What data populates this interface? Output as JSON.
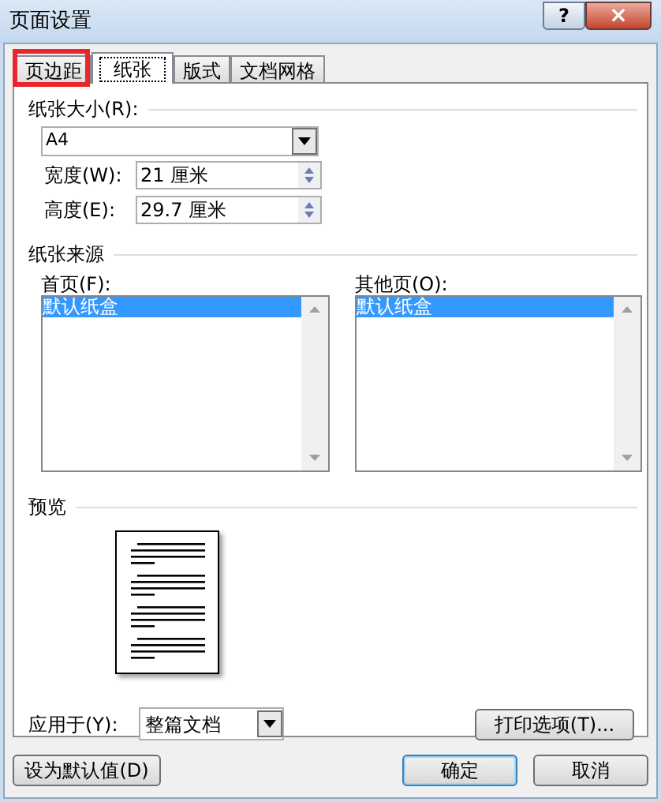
{
  "window": {
    "title": "页面设置",
    "help": "?",
    "close": "×"
  },
  "tabs": [
    {
      "label": "页边距",
      "selected": false
    },
    {
      "label": "纸张",
      "selected": true
    },
    {
      "label": "版式",
      "selected": false
    },
    {
      "label": "文档网格",
      "selected": false
    }
  ],
  "paper_size": {
    "label": "纸张大小(R):",
    "value": "A4",
    "width": {
      "label": "宽度(W):",
      "value": "21 厘米"
    },
    "height": {
      "label": "高度(E):",
      "value": "29.7 厘米"
    }
  },
  "paper_source": {
    "label": "纸张来源",
    "lists": [
      {
        "label": "首页(F):",
        "items": [
          {
            "label": "默认纸盒",
            "selected": true
          }
        ]
      },
      {
        "label": "其他页(O):",
        "items": [
          {
            "label": "默认纸盒",
            "selected": true
          }
        ]
      }
    ]
  },
  "preview": {
    "label": "预览"
  },
  "apply_to": {
    "label": "应用于(Y):",
    "value": "整篇文档"
  },
  "print_options_button": "打印选项(T)...",
  "buttons": [
    {
      "label": "设为默认值(D)",
      "kind": "plain"
    },
    {
      "label": "确定",
      "kind": "default"
    },
    {
      "label": "取消",
      "kind": "plain"
    }
  ]
}
